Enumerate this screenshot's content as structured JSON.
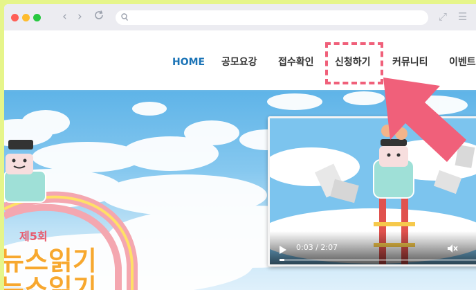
{
  "browser": {
    "url_text": ""
  },
  "nav": {
    "items": [
      {
        "label": "HOME",
        "active": true
      },
      {
        "label": "공모요강",
        "active": false
      },
      {
        "label": "접수확인",
        "active": false
      },
      {
        "label": "신청하기",
        "active": false,
        "highlighted": true
      },
      {
        "label": "커뮤니티",
        "active": false
      },
      {
        "label": "이벤트",
        "active": false
      }
    ]
  },
  "hero": {
    "edition": "제5회",
    "title_line1": "뉴스읽기",
    "title_line2": "뉴스읽기"
  },
  "video": {
    "timecode": "0:03 / 2:07",
    "progress": 0.024
  },
  "colors": {
    "accent_nav": "#1a73b6",
    "highlight": "#f0607a",
    "arrow": "#f0607a",
    "page_bg": "#e6f58a"
  }
}
